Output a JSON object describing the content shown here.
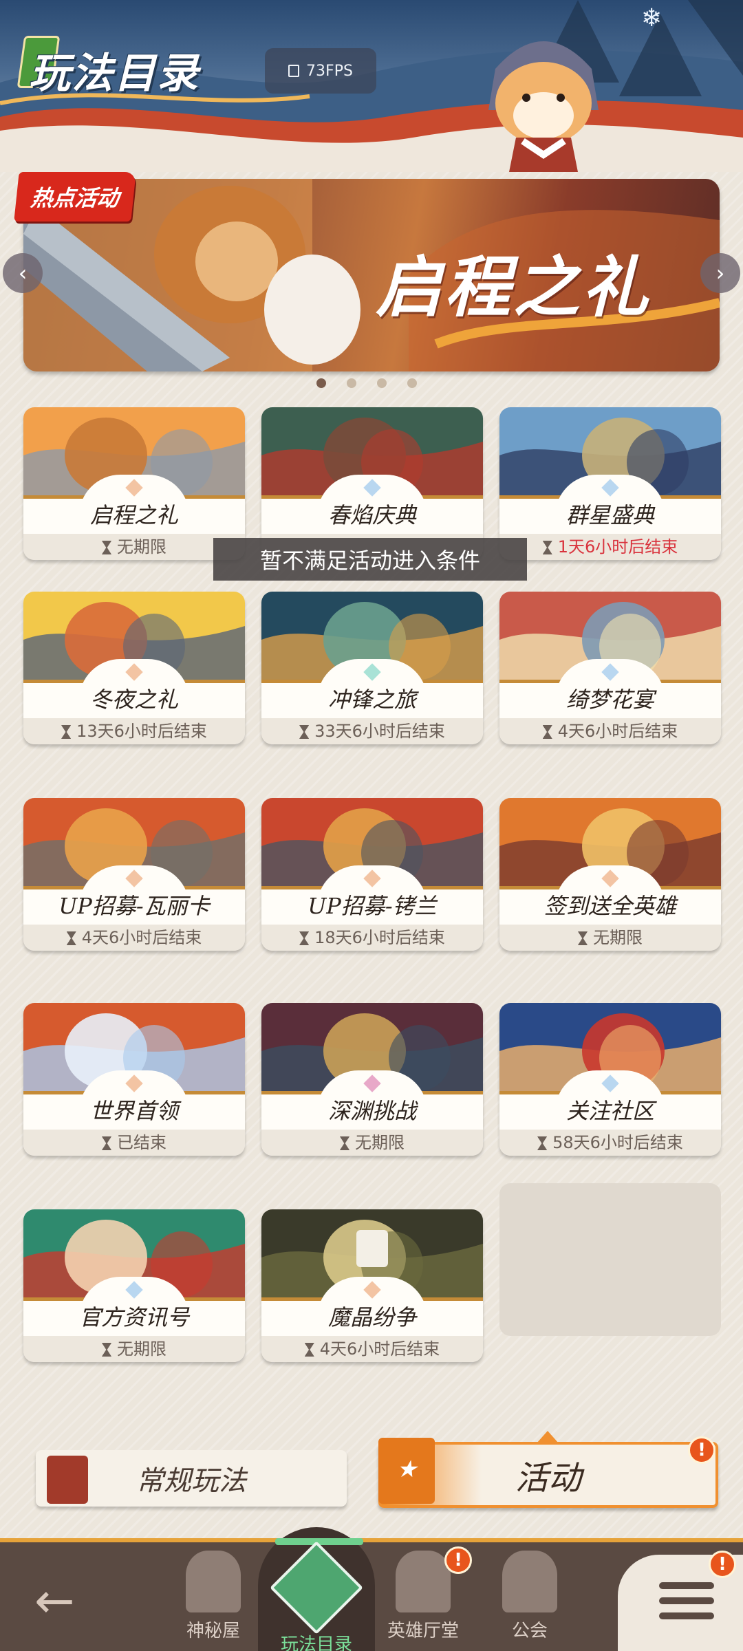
{
  "header": {
    "title": "玩法目录",
    "fps": "73FPS"
  },
  "banner": {
    "tag": "热点活动",
    "title": "启程之礼",
    "dots": 4,
    "active_dot": 1
  },
  "toast": "暂不满足活动进入条件",
  "cards": [
    {
      "name": "启程之礼",
      "status": "无期限",
      "status_color": "normal",
      "gem": "#f3c4a3"
    },
    {
      "name": "春焰庆典",
      "status": "",
      "status_color": "normal",
      "gem": "#b9d7f0"
    },
    {
      "name": "群星盛典",
      "status": "1天6小时后结束",
      "status_color": "red",
      "gem": "#b9d7f0"
    },
    {
      "name": "冬夜之礼",
      "status": "13天6小时后结束",
      "status_color": "normal",
      "gem": "#f3c4a3"
    },
    {
      "name": "冲锋之旅",
      "status": "33天6小时后结束",
      "status_color": "normal",
      "gem": "#a9e2d6"
    },
    {
      "name": "绮梦花宴",
      "status": "4天6小时后结束",
      "status_color": "normal",
      "gem": "#b9d7f0"
    },
    {
      "name": "UP招募-瓦丽卡",
      "status": "4天6小时后结束",
      "status_color": "normal",
      "gem": "#f3c4a3"
    },
    {
      "name": "UP招募-铐兰",
      "status": "18天6小时后结束",
      "status_color": "normal",
      "gem": "#f3c4a3"
    },
    {
      "name": "签到送全英雄",
      "status": "无期限",
      "status_color": "normal",
      "gem": "#f3c4a3"
    },
    {
      "name": "世界首领",
      "status": "已结束",
      "status_color": "normal",
      "gem": "#f3c4a3"
    },
    {
      "name": "深渊挑战",
      "status": "无期限",
      "status_color": "normal",
      "gem": "#e8a8c8"
    },
    {
      "name": "关注社区",
      "status": "58天6小时后结束",
      "status_color": "normal",
      "gem": "#b9d7f0"
    },
    {
      "name": "官方资讯号",
      "status": "无期限",
      "status_color": "normal",
      "gem": "#b9d7f0"
    },
    {
      "name": "魔晶纷争",
      "status": "4天6小时后结束",
      "status_color": "normal",
      "gem": "#f3c4a3"
    }
  ],
  "modes": {
    "normal": "常规玩法",
    "event": "活动",
    "event_badge": "!"
  },
  "nav": {
    "items": [
      {
        "label": "神秘屋",
        "badge": ""
      },
      {
        "label": "玩法目录",
        "badge": ""
      },
      {
        "label": "英雄厅堂",
        "badge": "!"
      },
      {
        "label": "公会",
        "badge": ""
      }
    ],
    "menu_badge": "!"
  },
  "colors": {
    "accent_green": "#4ea670",
    "alert_red": "#d9333d",
    "hot_tag": "#d8281c",
    "event_orange": "#f09030"
  }
}
